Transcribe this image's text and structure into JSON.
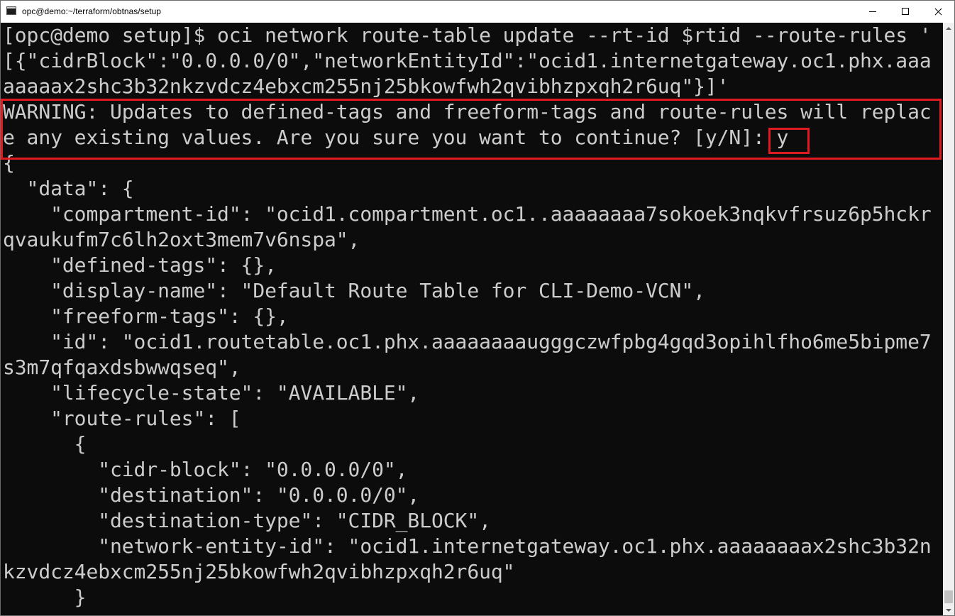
{
  "window": {
    "title": "opc@demo:~/terraform/obtnas/setup"
  },
  "terminal": {
    "lines": [
      "[opc@demo setup]$ oci network route-table update --rt-id $rtid --route-rules '",
      "[{\"cidrBlock\":\"0.0.0.0/0\",\"networkEntityId\":\"ocid1.internetgateway.oc1.phx.aaa",
      "aaaaax2shc3b32nkzvdcz4ebxcm255nj25bkowfwh2qvibhzpxqh2r6uq\"}]'",
      "WARNING: Updates to defined-tags and freeform-tags and route-rules will replac",
      "e any existing values. Are you sure you want to continue? [y/N]: y",
      "{",
      "  \"data\": {",
      "    \"compartment-id\": \"ocid1.compartment.oc1..aaaaaaaa7sokoek3nqkvfrsuz6p5hckr",
      "qvaukufm7c6lh2oxt3mem7v6nspa\",",
      "    \"defined-tags\": {},",
      "    \"display-name\": \"Default Route Table for CLI-Demo-VCN\",",
      "    \"freeform-tags\": {},",
      "    \"id\": \"ocid1.routetable.oc1.phx.aaaaaaaaugggczwfpbg4gqd3opihlfho6me5bipme7",
      "s3m7qfqaxdsbwwqseq\",",
      "    \"lifecycle-state\": \"AVAILABLE\",",
      "    \"route-rules\": [",
      "      {",
      "        \"cidr-block\": \"0.0.0.0/0\",",
      "        \"destination\": \"0.0.0.0/0\",",
      "        \"destination-type\": \"CIDR_BLOCK\",",
      "        \"network-entity-id\": \"ocid1.internetgateway.oc1.phx.aaaaaaaax2shc3b32n",
      "kzvdcz4ebxcm255nj25bkowfwh2qvibhzpxqh2r6uq\"",
      "      }"
    ]
  },
  "colors": {
    "background": "#0c0c0c",
    "text": "#cccccc",
    "highlight": "#e11a22"
  }
}
